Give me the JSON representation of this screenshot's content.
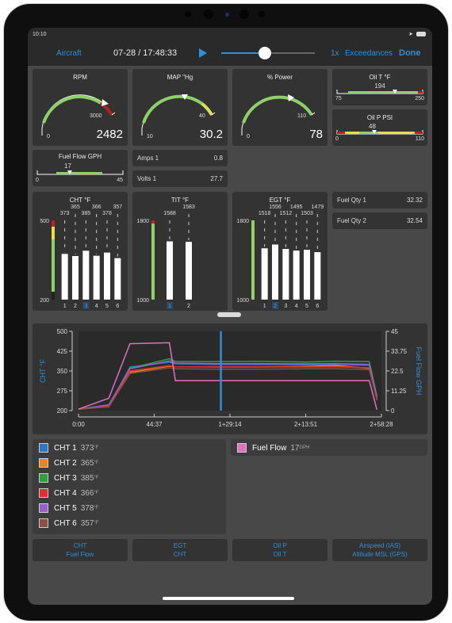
{
  "status_bar": {
    "time": "10:10"
  },
  "nav": {
    "aircraft_label": "Aircraft",
    "datetime": "07-28 / 17:48:33",
    "playback_progress": 0.47,
    "speed_label": "1x",
    "exceedances_label": "Exceedances",
    "done_label": "Done"
  },
  "gauges": {
    "rpm": {
      "title": "RPM",
      "min": "0",
      "max": "3000",
      "value": "2482",
      "fraction": 0.83
    },
    "map": {
      "title": "MAP \"Hg",
      "min": "10",
      "max": "40",
      "value": "30.2",
      "fraction": 0.67
    },
    "power": {
      "title": "% Power",
      "min": "0",
      "max": "110",
      "value": "78",
      "fraction": 0.71
    },
    "oil_t": {
      "title": "Oil T °F",
      "min": "75",
      "max": "250",
      "value": "194",
      "fraction": 0.68
    },
    "oil_p": {
      "title": "Oil P PSI",
      "min": "0",
      "max": "110",
      "value": "48",
      "fraction": 0.44
    },
    "fuel_flow": {
      "title": "Fuel Flow GPH",
      "min": "0",
      "max": "45",
      "value": "17",
      "fraction": 0.38
    }
  },
  "readouts": {
    "amps1": {
      "label": "Amps 1",
      "value": "0.8"
    },
    "volts1": {
      "label": "Volts 1",
      "value": "27.7"
    },
    "fuel_qty1": {
      "label": "Fuel Qty 1",
      "value": "32.32"
    },
    "fuel_qty2": {
      "label": "Fuel Qty 2",
      "value": "32.54"
    }
  },
  "bar_gauges": {
    "cht": {
      "title": "CHT °F",
      "min": 200,
      "max": 500,
      "min_label": "200",
      "max_label": "500",
      "values": [
        373,
        365,
        385,
        366,
        378,
        357
      ],
      "labels": [
        "1",
        "2",
        "3",
        "4",
        "5",
        "6"
      ],
      "highlight": 2
    },
    "tit": {
      "title": "TIT °F",
      "min": 1000,
      "max": 1800,
      "min_label": "1000",
      "max_label": "1800",
      "values": [
        1588,
        1583
      ],
      "labels": [
        "1",
        "2"
      ],
      "highlight": 0
    },
    "egt": {
      "title": "EGT °F",
      "min": 1000,
      "max": 1800,
      "min_label": "1000",
      "max_label": "1800",
      "values": [
        1518,
        1556,
        1512,
        1495,
        1503,
        1479
      ],
      "labels": [
        "1",
        "2",
        "3",
        "4",
        "5",
        "6"
      ],
      "highlight": 1
    }
  },
  "chart_data": {
    "type": "line",
    "title": "",
    "ylabel": "CHT °F",
    "y2label": "Fuel Flow GPH",
    "ylim": [
      200,
      500
    ],
    "y2lim": [
      0,
      45
    ],
    "yticks": [
      "500",
      "425",
      "350",
      "275",
      "200"
    ],
    "y2ticks": [
      "45",
      "33.75",
      "22.5",
      "11.25",
      "0"
    ],
    "xticks": [
      "0:00",
      "44:37",
      "1+29:14",
      "2+13:51",
      "2+58:28"
    ],
    "cursor_fraction": 0.47,
    "series": [
      {
        "name": "CHT 1",
        "color": "#2a78c8",
        "values": [
          205,
          215,
          365,
          383,
          377,
          375,
          374,
          373,
          373,
          372,
          250
        ]
      },
      {
        "name": "CHT 2",
        "color": "#f08020",
        "values": [
          205,
          215,
          345,
          368,
          366,
          365,
          365,
          367,
          370,
          360,
          240
        ]
      },
      {
        "name": "CHT 3",
        "color": "#2ea043",
        "values": [
          205,
          220,
          360,
          396,
          386,
          385,
          386,
          384,
          387,
          385,
          255
        ]
      },
      {
        "name": "CHT 4",
        "color": "#d93030",
        "values": [
          205,
          218,
          350,
          370,
          366,
          366,
          365,
          365,
          366,
          362,
          245
        ]
      },
      {
        "name": "CHT 5",
        "color": "#9a60c8",
        "values": [
          205,
          222,
          358,
          388,
          380,
          378,
          378,
          377,
          378,
          375,
          250
        ]
      },
      {
        "name": "CHT 6",
        "color": "#8a5040",
        "values": [
          205,
          214,
          340,
          362,
          358,
          357,
          357,
          358,
          358,
          355,
          240
        ]
      },
      {
        "name": "Fuel Flow",
        "color": "#e070c0",
        "axis": "right",
        "values": [
          0.8,
          7,
          38,
          38.5,
          17,
          17,
          17,
          17,
          17,
          17,
          0.5
        ]
      }
    ],
    "x_fractions": [
      0.0,
      0.1,
      0.17,
      0.3,
      0.32,
      0.45,
      0.6,
      0.75,
      0.85,
      0.96,
      0.985
    ]
  },
  "legend": [
    {
      "name": "CHT 1",
      "value": "373",
      "unit": "°F",
      "color": "#2a78c8"
    },
    {
      "name": "CHT 2",
      "value": "365",
      "unit": "°F",
      "color": "#f08020"
    },
    {
      "name": "CHT 3",
      "value": "385",
      "unit": "°F",
      "color": "#2ea043"
    },
    {
      "name": "CHT 4",
      "value": "366",
      "unit": "°F",
      "color": "#d93030"
    },
    {
      "name": "CHT 5",
      "value": "378",
      "unit": "°F",
      "color": "#9a60c8"
    },
    {
      "name": "CHT 6",
      "value": "357",
      "unit": "°F",
      "color": "#8a5040"
    }
  ],
  "legend_right": {
    "name": "Fuel Flow",
    "value": "17",
    "unit": "GPH",
    "color": "#e070c0"
  },
  "preset_buttons": [
    {
      "line1": "CHT",
      "line2": "Fuel Flow"
    },
    {
      "line1": "EGT",
      "line2": "CHT"
    },
    {
      "line1": "Oil P",
      "line2": "Oil T"
    },
    {
      "line1": "Airspeed (IAS)",
      "line2": "Altitude MSL (GPS)"
    }
  ]
}
